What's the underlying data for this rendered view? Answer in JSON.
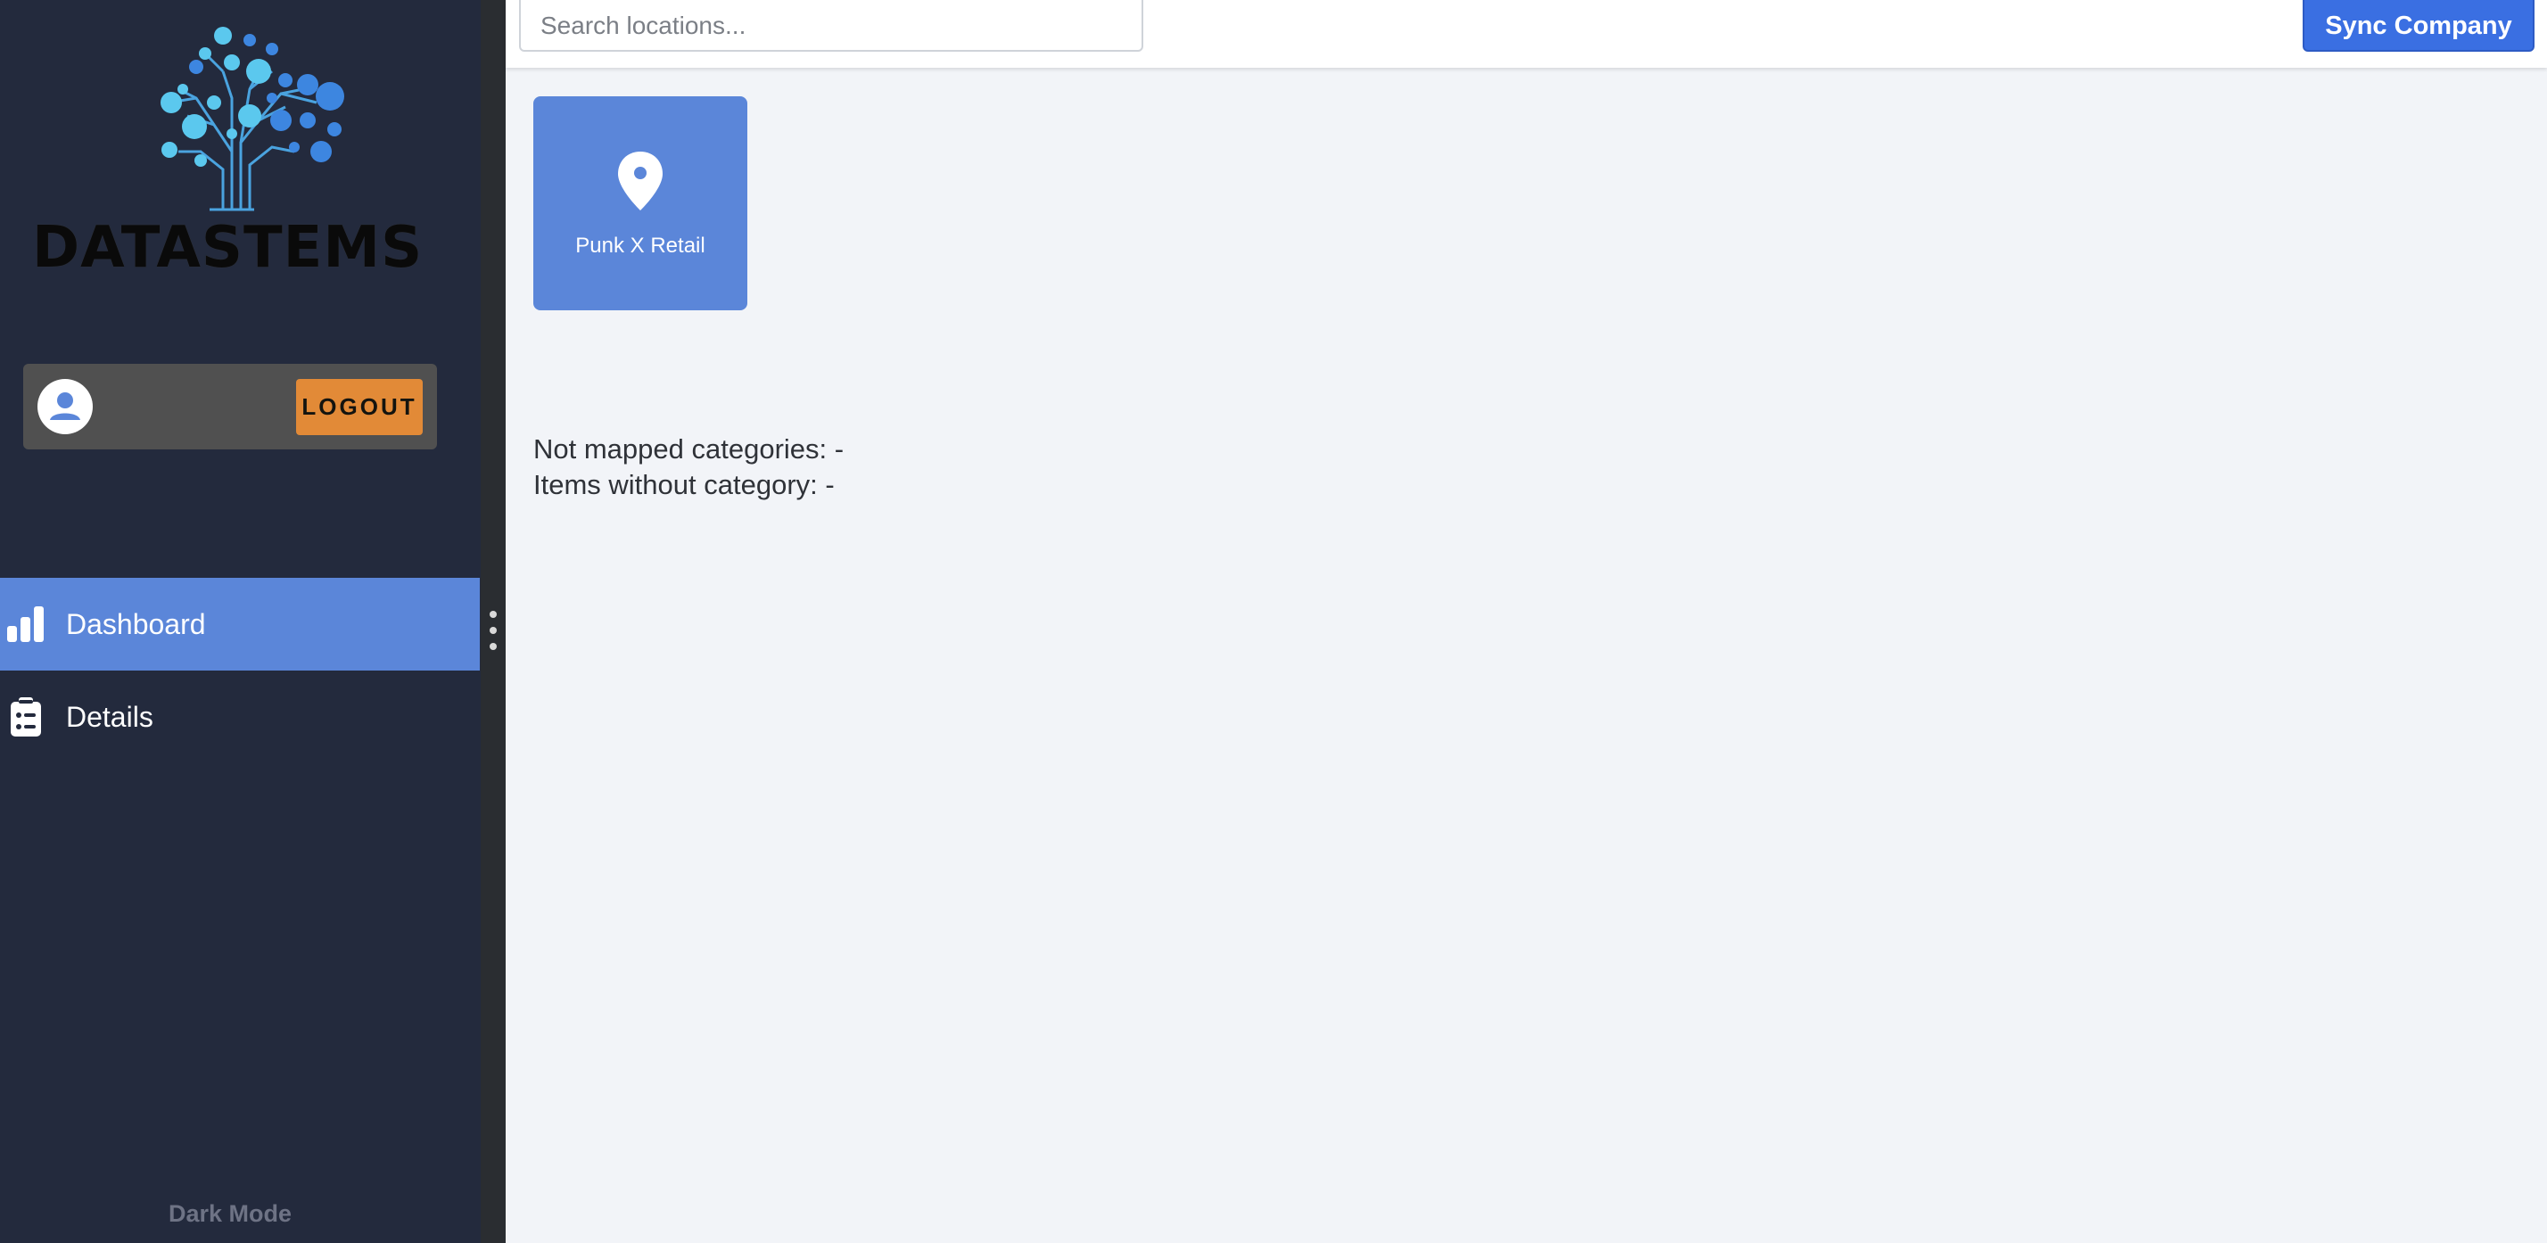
{
  "brand": {
    "name": "DATASTEMS"
  },
  "user_card": {
    "logout_label": "LOGOUT"
  },
  "sidebar": {
    "items": [
      {
        "label": "Dashboard",
        "icon": "bar-chart-icon",
        "active": true
      },
      {
        "label": "Details",
        "icon": "clipboard-list-icon",
        "active": false
      }
    ],
    "dark_mode_label": "Dark Mode"
  },
  "header": {
    "search_placeholder": "Search locations...",
    "sync_label": "Sync Company"
  },
  "locations": [
    {
      "name": "Punk X Retail",
      "icon": "map-pin-icon"
    }
  ],
  "stats": {
    "not_mapped": "Not mapped categories: -",
    "without_category": "Items without category: -"
  },
  "colors": {
    "sidebar_bg": "#232a3d",
    "accent": "#5b86d9",
    "logout": "#e28a37",
    "sync": "#3a6fe2",
    "main_bg": "#f2f4f8"
  }
}
